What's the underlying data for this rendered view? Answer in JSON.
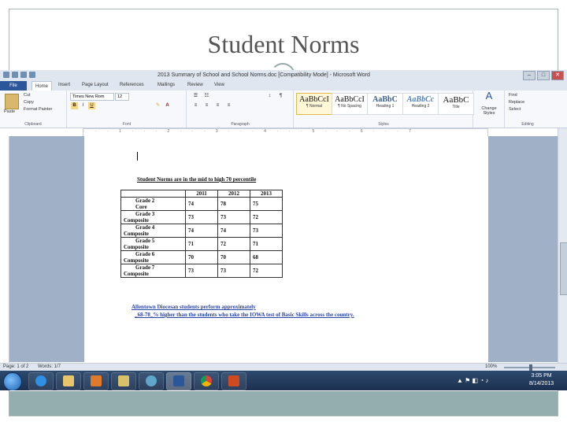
{
  "slide": {
    "title": "Student Norms"
  },
  "word": {
    "window_title": "2013 Summary of School and School Norms.doc [Compatibility Mode] - Microsoft Word",
    "tabs": [
      "File",
      "Home",
      "Insert",
      "Page Layout",
      "References",
      "Mailings",
      "Review",
      "View"
    ],
    "clipboard": {
      "paste": "Paste",
      "cut": "Cut",
      "copy": "Copy",
      "format_painter": "Format Painter",
      "label": "Clipboard"
    },
    "font": {
      "name": "Times New Rom",
      "size": "12",
      "label": "Font"
    },
    "paragraph_label": "Paragraph",
    "styles": [
      {
        "sample": "AaBbCcI",
        "name": "¶ Normal"
      },
      {
        "sample": "AaBbCcI",
        "name": "¶ No Spacing"
      },
      {
        "sample": "AaBbC",
        "name": "Heading 1"
      },
      {
        "sample": "AaBbCc",
        "name": "Heading 2"
      },
      {
        "sample": "AaBbC",
        "name": "Title"
      }
    ],
    "styles_label": "Styles",
    "change_styles": "Change Styles",
    "editing": {
      "find": "Find",
      "replace": "Replace",
      "select": "Select",
      "label": "Editing"
    },
    "status": {
      "page": "Page: 1 of 2",
      "words": "Words: 1/7",
      "zoom": "100%"
    }
  },
  "document": {
    "heading": "Student Norms are in the mid  to high 70 percentile",
    "table": {
      "headers": [
        "",
        "2011",
        "2012",
        "2013"
      ],
      "rows": [
        {
          "label1": "Grade 2",
          "label2": "Core",
          "v2011": "74",
          "v2012": "78",
          "v2013": "75"
        },
        {
          "label1": "Grade 3",
          "label2": "Composite",
          "v2011": "73",
          "v2012": "73",
          "v2013": "72"
        },
        {
          "label1": "Grade 4",
          "label2": "Composite",
          "v2011": "74",
          "v2012": "74",
          "v2013": "73"
        },
        {
          "label1": "Grade 5",
          "label2": "Composite",
          "v2011": "71",
          "v2012": "72",
          "v2013": "71"
        },
        {
          "label1": "Grade 6",
          "label2": "Composite",
          "v2011": "70",
          "v2012": "70",
          "v2013": "68"
        },
        {
          "label1": "Grade 7",
          "label2": "Composite",
          "v2011": "73",
          "v2012": "73",
          "v2013": "72"
        }
      ]
    },
    "note_line1": "Allentown Diocesan students perform  approximately",
    "note_line2": "_68-78_% higher than the students who take the IOWA test of Basic Skills across the country."
  },
  "taskbar": {
    "time": "3:05 PM",
    "date": "8/14/2013"
  },
  "colors": {
    "word_blue": "#2b579a",
    "taskbar": "#1c3150",
    "footer_band": "#94aeb0",
    "note_blue": "#2a45a7"
  }
}
